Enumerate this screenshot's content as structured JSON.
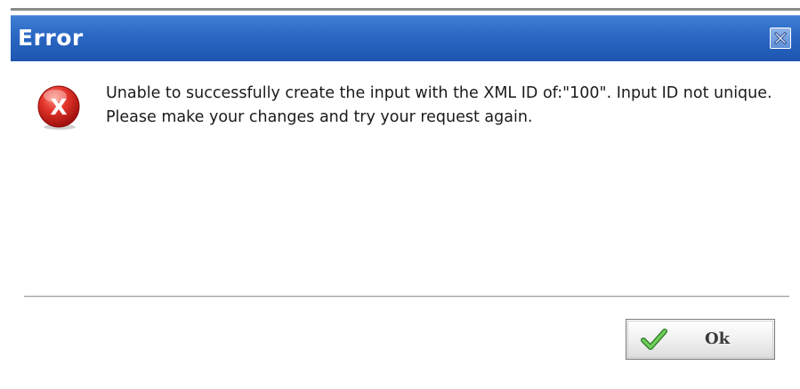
{
  "dialog": {
    "title": "Error",
    "message": "Unable to successfully create the input with the XML ID of:\"100\". Input ID not unique. Please make your changes and try your request again.",
    "icon": "error-x-icon",
    "close_icon": "close-icon"
  },
  "buttons": {
    "ok_label": "Ok",
    "ok_icon": "checkmark-icon"
  },
  "colors": {
    "titlebar": "#2a67c3",
    "title_text": "#ffffff",
    "error_red": "#d8221e",
    "check_green": "#3fa83a"
  }
}
